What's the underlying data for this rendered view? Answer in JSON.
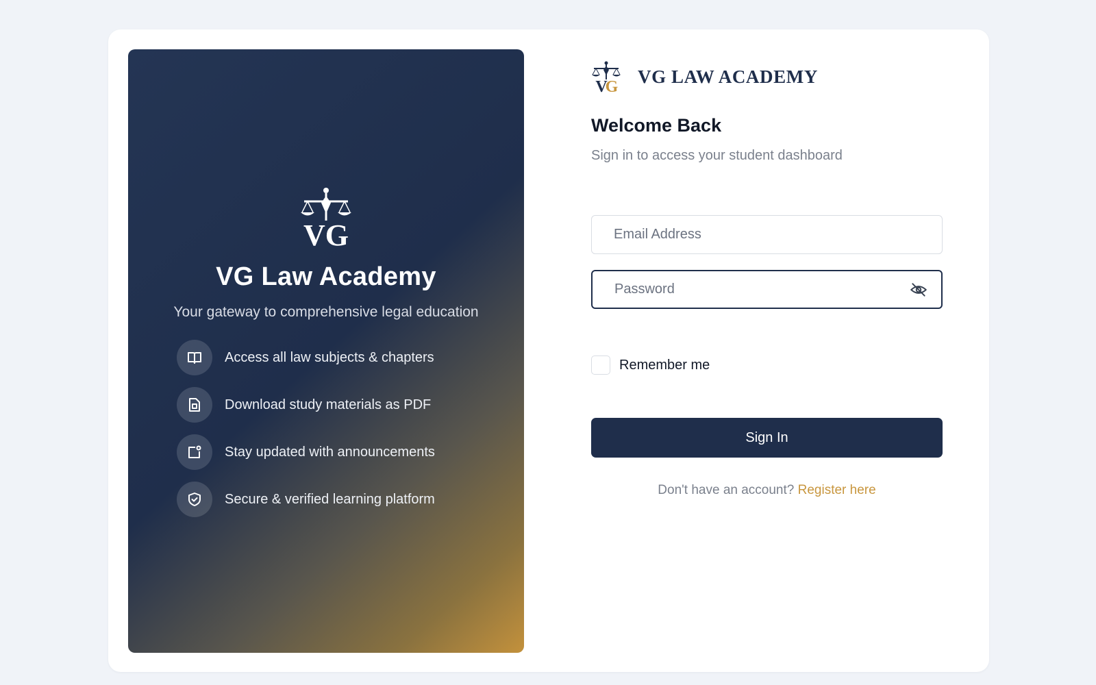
{
  "hero": {
    "title": "VG Law Academy",
    "subtitle": "Your gateway to comprehensive legal education",
    "logo_text": "VG",
    "features": [
      {
        "icon": "book-open-icon",
        "label": "Access all law subjects & chapters"
      },
      {
        "icon": "file-pdf-icon",
        "label": "Download study materials as PDF"
      },
      {
        "icon": "announcement-icon",
        "label": "Stay updated with announcements"
      },
      {
        "icon": "shield-check-icon",
        "label": "Secure & verified learning platform"
      }
    ]
  },
  "brand": {
    "name": "VG LAW ACADEMY",
    "logo_text": "VG"
  },
  "form": {
    "title": "Welcome Back",
    "subtitle": "Sign in to access your student dashboard",
    "email": {
      "placeholder": "Email Address",
      "value": ""
    },
    "password": {
      "placeholder": "Password",
      "value": ""
    },
    "remember_label": "Remember me",
    "remember_checked": false,
    "submit_label": "Sign In",
    "register_prompt": "Don't have an account?",
    "register_link": "Register here"
  },
  "colors": {
    "navy": "#1f2e4b",
    "gold": "#c8963e",
    "page_bg": "#f0f3f8"
  }
}
